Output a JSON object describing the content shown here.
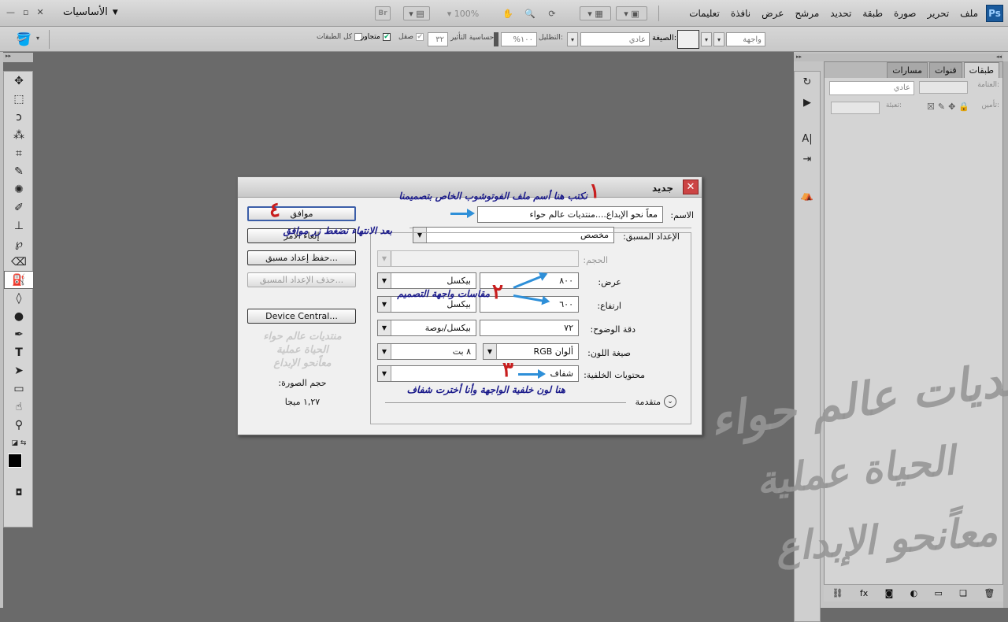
{
  "menubar": {
    "logo": "Ps",
    "items": [
      "ملف",
      "تحرير",
      "صورة",
      "طبقة",
      "تحديد",
      "مرشح",
      "عرض",
      "نافذة",
      "تعليمات"
    ],
    "bridge": "Br",
    "zoom": "100%",
    "workspace": "الأساسيات",
    "win_min": "—",
    "win_restore": "▫",
    "win_close": "✕"
  },
  "options_bar": {
    "mode_label": "الصيغة:",
    "mode_value": "عادي",
    "fill_value": "واجهة",
    "opacity_label": "التظليل:",
    "opacity_value": "١٠٠%",
    "tolerance_label": "حساسية التأثير:",
    "tolerance_value": "٣٢",
    "antialias_label": "صقل",
    "contiguous_label": "متجاور",
    "all_layers_label": "كل الطبقات"
  },
  "layers_panel": {
    "tabs": [
      "طبقات",
      "قنوات",
      "مسارات"
    ],
    "blend_value": "عادي",
    "opacity_label": "العتامة:",
    "lock_label": "تأمين:",
    "fill_label": "تعبئة:",
    "bottom_icons": [
      "⛓",
      "fx",
      "◙",
      "◐",
      "▭",
      "❏",
      "🗑"
    ]
  },
  "dialog": {
    "title": "جديد",
    "close": "✕",
    "name_label": "الاسم:",
    "name_value": "معاً نحو الإبداع....منتديات عالم حواء",
    "preset_label": "الإعداد المسبق:",
    "preset_value": "مخصص",
    "size_label": "الحجم:",
    "width_label": "عرض:",
    "width_value": "٨٠٠",
    "width_unit": "بيكسل",
    "height_label": "ارتفاع:",
    "height_value": "٦٠٠",
    "height_unit": "بيكسل",
    "resolution_label": "دقة الوضوح:",
    "resolution_value": "٧٢",
    "resolution_unit": "بيكسل/بوصة",
    "color_mode_label": "صيغة اللون:",
    "color_mode_value": "ألوان RGB",
    "bit_depth": "٨ بت",
    "background_label": "محتويات الخلفية:",
    "background_value": "شفاف",
    "advanced_label": "متقدمة",
    "ok_button": "موافق",
    "cancel_button": "إلغاء الأمر",
    "save_preset_button": "حفظ إعداد مسبق...",
    "delete_preset_button": "حذف الإعداد المسبق...",
    "device_central_button": "Device Central...",
    "image_size_label": "حجم الصورة:",
    "image_size_value": "١,٢٧ ميجا"
  },
  "annotations": {
    "n1": "١",
    "note1": "نكتب هنا أسم ملف الفوتوشوب الخاص بتصميمنا",
    "n2": "٢",
    "note2": "مقاسات واجهة التصميم",
    "n3": "٣",
    "note3": "هنا لون خلفية الواجهة وأنا أخترت شفاف",
    "n4": "٤",
    "note4": "بعد الانتهاء نضغط زر موافق"
  },
  "watermark": {
    "line1": "منتديات عالم حواء",
    "line2": "الحياة عملية",
    "line3": "معاًنحو الإبداع"
  }
}
